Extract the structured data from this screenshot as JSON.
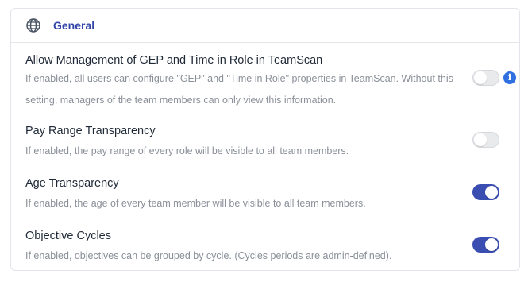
{
  "header": {
    "title": "General",
    "icon": "globe-icon"
  },
  "settings": [
    {
      "title": "Allow Management of GEP and Time in Role in TeamScan",
      "description": "If enabled, all users can configure \"GEP\" and \"Time in Role\" properties in TeamScan. Without this setting, managers of the team members can only view this information.",
      "enabled": false,
      "has_info": true
    },
    {
      "title": "Pay Range Transparency",
      "description": "If enabled, the pay range of every role will be visible to all team members.",
      "enabled": false
    },
    {
      "title": "Age Transparency",
      "description": "If enabled, the age of every team member will be visible to all team members.",
      "enabled": true
    },
    {
      "title": "Objective Cycles",
      "description": "If enabled, objectives can be grouped by cycle. (Cycles periods are admin-defined).",
      "enabled": true
    }
  ],
  "colors": {
    "accent": "#3a4db1",
    "info": "#2f6fe0",
    "header_text": "#3346a8"
  },
  "info_icon_glyph": "i"
}
